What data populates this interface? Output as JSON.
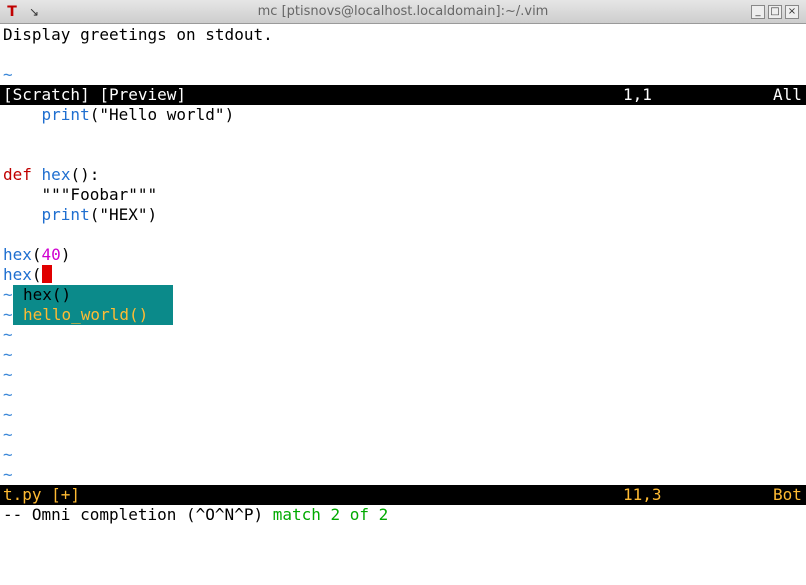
{
  "window": {
    "title": "mc [ptisnovs@localhost.localdomain]:~/.vim",
    "app_icon": "T",
    "pin_icon": "↘",
    "minimize": "_",
    "maximize": "□",
    "close": "×"
  },
  "preview": {
    "text": "Display greetings on stdout.",
    "tilde": "~"
  },
  "preview_status": {
    "name": "[Scratch] [Preview]",
    "position": "1,1",
    "scroll": "All"
  },
  "code": {
    "indent": "    ",
    "print1_fn": "print",
    "print1_args": "(\"Hello world\")",
    "def_kw": "def",
    "def_name": "hex",
    "def_rest": "():",
    "docstring": "\"\"\"Foobar\"\"\"",
    "print2_fn": "print",
    "print2_args": "(\"HEX\")",
    "call1_fn": "hex",
    "call1_open": "(",
    "call1_arg": "40",
    "call1_close": ")",
    "call2_fn": "hex",
    "call2_open": "("
  },
  "completion_popup": {
    "items": [
      "hex()",
      "hello_world()"
    ],
    "selected_index": 0
  },
  "tilde": "~",
  "status": {
    "file": "t.py [+]",
    "position": "11,3",
    "scroll": "Bot"
  },
  "message": {
    "mode": "-- Omni completion (^O^N^P) ",
    "match": "match 2 of 2"
  },
  "colors": {
    "keyword": "#c00000",
    "function": "#1f6fd0",
    "number": "#d000d0",
    "popup_bg": "#0b8a8a",
    "status_fg": "#ffbb33",
    "match": "#00aa00"
  }
}
